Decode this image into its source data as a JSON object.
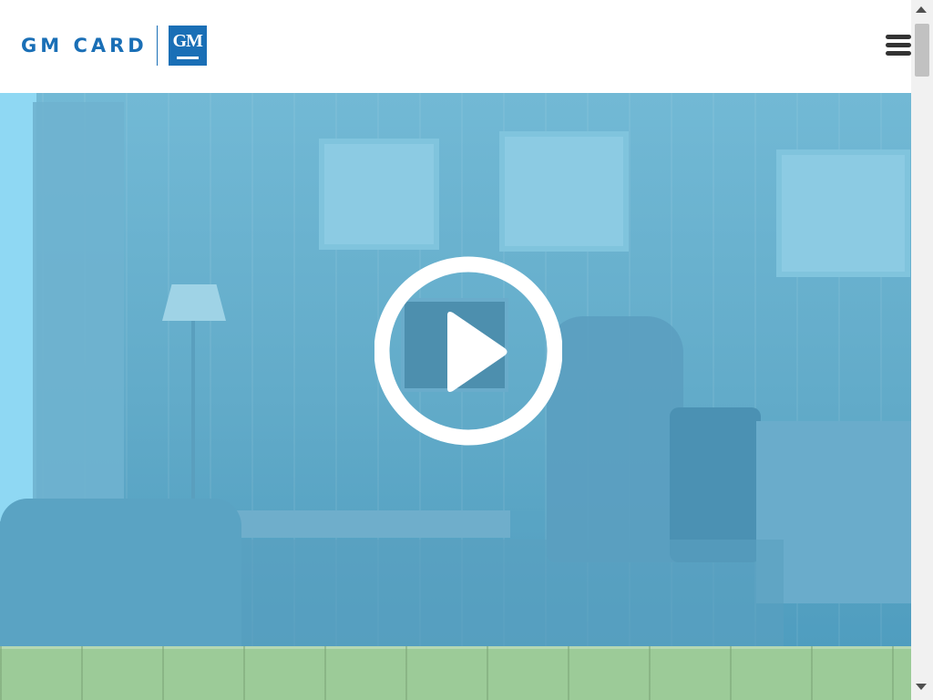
{
  "header": {
    "brand_text": "GM CARD",
    "logo_text": "GM",
    "menu_icon": "hamburger-menu-icon"
  },
  "hero": {
    "play_icon": "play-icon",
    "overlay_color": "#5faed0"
  },
  "colors": {
    "brand_blue": "#1a6fb6",
    "bottom_band": "#9ccb98"
  }
}
